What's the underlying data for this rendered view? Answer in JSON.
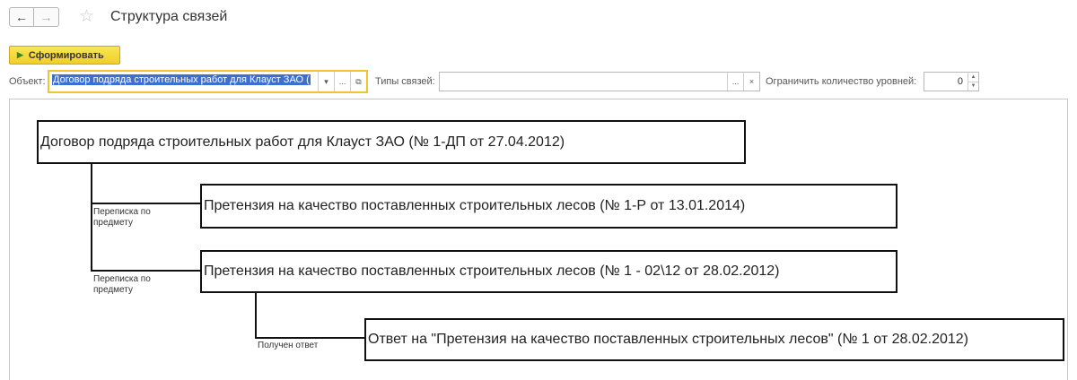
{
  "header": {
    "title": "Структура связей",
    "back_icon": "←",
    "forward_icon": "→",
    "favorite_icon": "☆"
  },
  "toolbar": {
    "generate_label": "Сформировать"
  },
  "params": {
    "object_label": "Объект:",
    "object_value": "Договор подряда строительных работ для Клауст ЗАО (",
    "link_types_label": "Типы связей:",
    "link_types_value": "",
    "levels_label": "Ограничить количество уровней:",
    "levels_value": "0",
    "dropdown_icon": "▾",
    "choose_icon": "...",
    "open_icon": "⧉",
    "clear_icon": "×"
  },
  "diagram": {
    "nodes": [
      {
        "text": "Договор подряда строительных работ для Клауст ЗАО (№ 1-ДП от 27.04.2012)"
      },
      {
        "text": "Претензия на качество поставленных строительных лесов (№ 1-Р от 13.01.2014)"
      },
      {
        "text": "Претензия на качество поставленных строительных лесов (№ 1 - 02\\12 от 28.02.2012)"
      },
      {
        "text": "Ответ на \"Претензия на качество поставленных строительных лесов\" (№ 1 от 28.02.2012)"
      }
    ],
    "edges": [
      {
        "label_line1": "Переписка по",
        "label_line2": "предмету"
      },
      {
        "label_line1": "Переписка по",
        "label_line2": "предмету"
      },
      {
        "label_line1": "Получен ответ",
        "label_line2": ""
      }
    ]
  },
  "colors": {
    "generate_button": "#f0ce2b",
    "active_field_border": "#f1c232",
    "selection": "#3d6fd0",
    "node_border": "#111111"
  }
}
